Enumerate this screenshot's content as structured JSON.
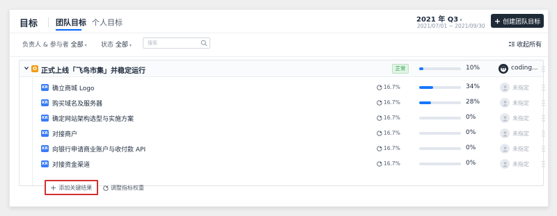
{
  "header": {
    "title": "目标",
    "tabs": [
      {
        "label": "团队目标",
        "active": true
      },
      {
        "label": "个人目标",
        "active": false
      }
    ],
    "period": "2021 年 Q3",
    "period_range": "2021/07/01 ~ 2021/09/30",
    "create_button": "创建团队目标"
  },
  "filters": {
    "owner_label": "负责人 & 参与者",
    "owner_value": "全部",
    "status_label": "状态",
    "status_value": "全部",
    "search_placeholder": "搜索",
    "collapse_all": "收起所有"
  },
  "objective": {
    "badge": "O",
    "title": "正式上线「飞鸟市集」并稳定运行",
    "status": "正常",
    "progress": 0.1,
    "progress_text": "10%",
    "owner": "coding...",
    "key_results": [
      {
        "tag": "KR",
        "title": "确立商城 Logo",
        "weight": "16.7%",
        "progress": 0.34,
        "progress_text": "34%",
        "assignee": "未指定"
      },
      {
        "tag": "KR",
        "title": "购买域名及服务器",
        "weight": "16.7%",
        "progress": 0.28,
        "progress_text": "28%",
        "assignee": "未指定"
      },
      {
        "tag": "KR",
        "title": "确定网站架构选型与实施方案",
        "weight": "16.7%",
        "progress": 0,
        "progress_text": "0%",
        "assignee": "未指定"
      },
      {
        "tag": "KR",
        "title": "对接商户",
        "weight": "16.7%",
        "progress": 0,
        "progress_text": "0%",
        "assignee": "未指定"
      },
      {
        "tag": "KR",
        "title": "向银行申请商业账户与收付款 API",
        "weight": "16.7%",
        "progress": 0,
        "progress_text": "0%",
        "assignee": "未指定"
      },
      {
        "tag": "KR",
        "title": "对接资金渠道",
        "weight": "16.7%",
        "progress": 0,
        "progress_text": "0%",
        "assignee": "未指定"
      }
    ],
    "add_kr": "添加关键结果",
    "adjust_weight": "调整指标权重"
  },
  "colors": {
    "accent": "#0066ff",
    "progress_fill": "#1677ff",
    "status_green": "#27a046",
    "objective_badge": "#f39c12",
    "kr_badge": "#3a7cf7",
    "highlight_border": "#d32f2f"
  },
  "icons": [
    "plus-icon",
    "caret-down-icon",
    "search-icon",
    "collapse-icon",
    "chevron-down-icon",
    "pie-chart-icon",
    "user-icon",
    "drag-handle-icon"
  ]
}
